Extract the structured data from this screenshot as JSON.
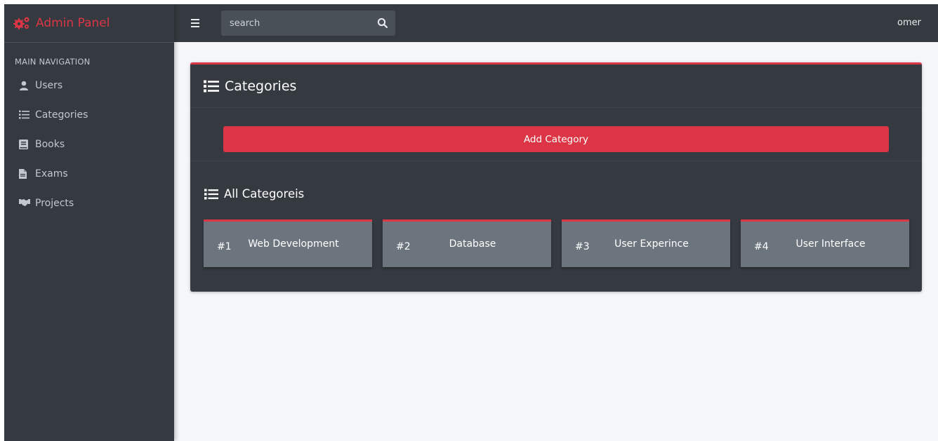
{
  "theme": {
    "accent": "#dc3545",
    "dark": "#343a40",
    "card_gray": "#6c757d"
  },
  "brand": {
    "title": "Admin Panel",
    "icon": "cogs-icon"
  },
  "sidebar": {
    "header": "MAIN NAVIGATION",
    "items": [
      {
        "label": "Users",
        "icon": "user-icon"
      },
      {
        "label": "Categories",
        "icon": "list-icon"
      },
      {
        "label": "Books",
        "icon": "book-icon"
      },
      {
        "label": "Exams",
        "icon": "file-icon"
      },
      {
        "label": "Projects",
        "icon": "handshake-icon"
      }
    ]
  },
  "topbar": {
    "menu_icon": "bars-icon",
    "search": {
      "placeholder": "search",
      "icon": "search-icon"
    },
    "user": "omer"
  },
  "card": {
    "title": "Categories",
    "add_button": "Add Category",
    "section_title": "All Categoreis",
    "categories": [
      {
        "number": "#1",
        "name": "Web Development"
      },
      {
        "number": "#2",
        "name": "Database"
      },
      {
        "number": "#3",
        "name": "User Experince"
      },
      {
        "number": "#4",
        "name": "User Interface"
      }
    ]
  }
}
